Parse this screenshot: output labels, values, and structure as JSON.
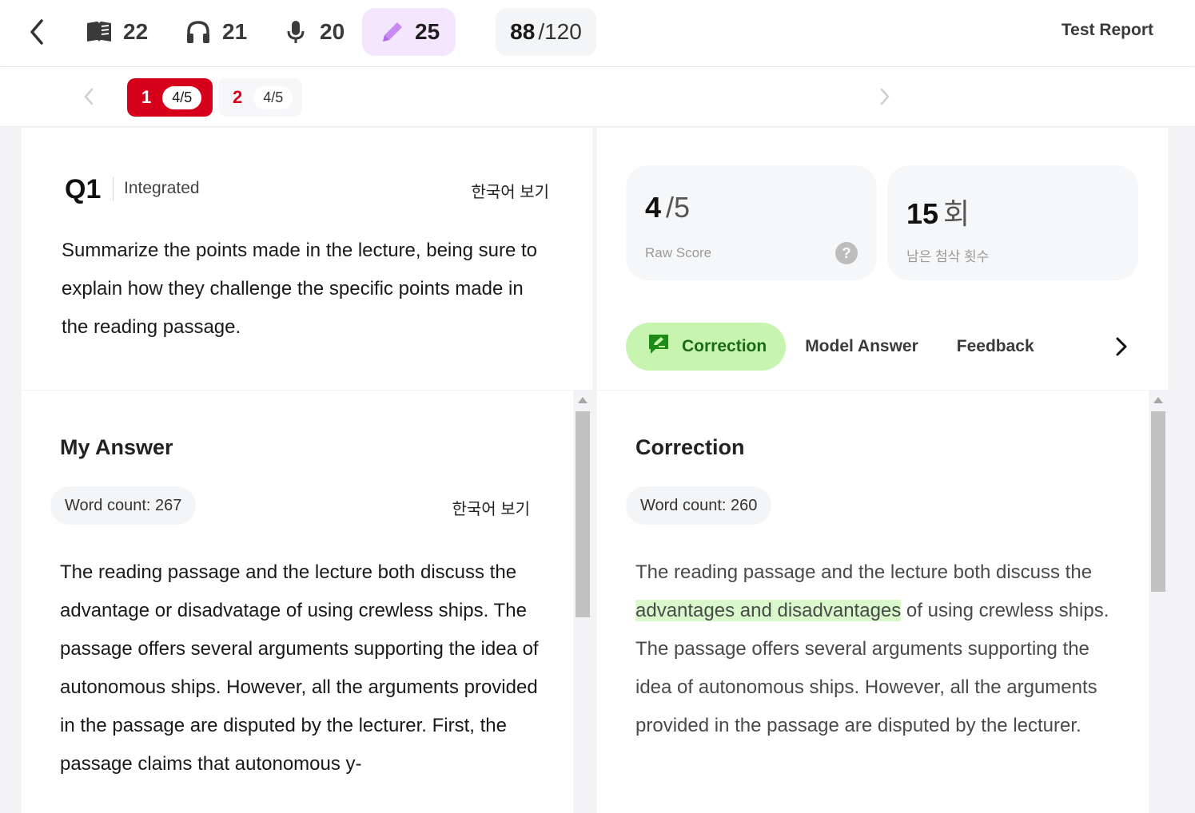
{
  "header": {
    "sections": [
      {
        "name": "reading",
        "icon": "book-icon",
        "score": "22"
      },
      {
        "name": "listening",
        "icon": "headphones-icon",
        "score": "21"
      },
      {
        "name": "speaking",
        "icon": "microphone-icon",
        "score": "20"
      },
      {
        "name": "writing",
        "icon": "pencil-icon",
        "score": "25"
      }
    ],
    "total": {
      "score": "88",
      "max": "/120"
    },
    "report_label": "Test Report"
  },
  "question_tabs": [
    {
      "number": "1",
      "score": "4/5"
    },
    {
      "number": "2",
      "score": "4/5"
    }
  ],
  "question": {
    "label": "Q1",
    "type": "Integrated",
    "korean_toggle": "한국어 보기",
    "prompt": "Summarize the points made in the lecture, being sure to explain how they challenge the specific points made in the reading passage."
  },
  "scores": {
    "raw": {
      "value": "4",
      "suffix": "/5",
      "caption": "Raw Score"
    },
    "remaining": {
      "value": "15",
      "suffix": "회",
      "caption": "남은 첨삭 횟수"
    }
  },
  "result_tabs": [
    {
      "label": "Correction"
    },
    {
      "label": "Model Answer"
    },
    {
      "label": "Feedback"
    }
  ],
  "my_answer": {
    "title": "My Answer",
    "word_count": "Word count: 267",
    "korean_toggle": "한국어 보기",
    "text": "The reading passage and the lecture both discuss the advantage or disadvatage of using crewless ships. The passage offers several arguments supporting the idea of autonomous ships. However, all the arguments provided in the passage are disputed by the lecturer. First, the passage claims that autonomous y-"
  },
  "correction": {
    "title": "Correction",
    "word_count": "Word count: 260",
    "text_before": "The reading passage and the lecture both discuss the ",
    "highlight": "advantages and disadvantages",
    "text_after": " of using crewless ships. The passage offers several arguments supporting the idea of autonomous ships. However, all the arguments provided in the passage are disputed by the lecturer."
  },
  "colors": {
    "accent_red": "#d6001c",
    "writing_active_bg": "#f3e6fd",
    "correction_tab_bg": "#c7f5b0",
    "highlight_green": "#d9f8cb"
  }
}
